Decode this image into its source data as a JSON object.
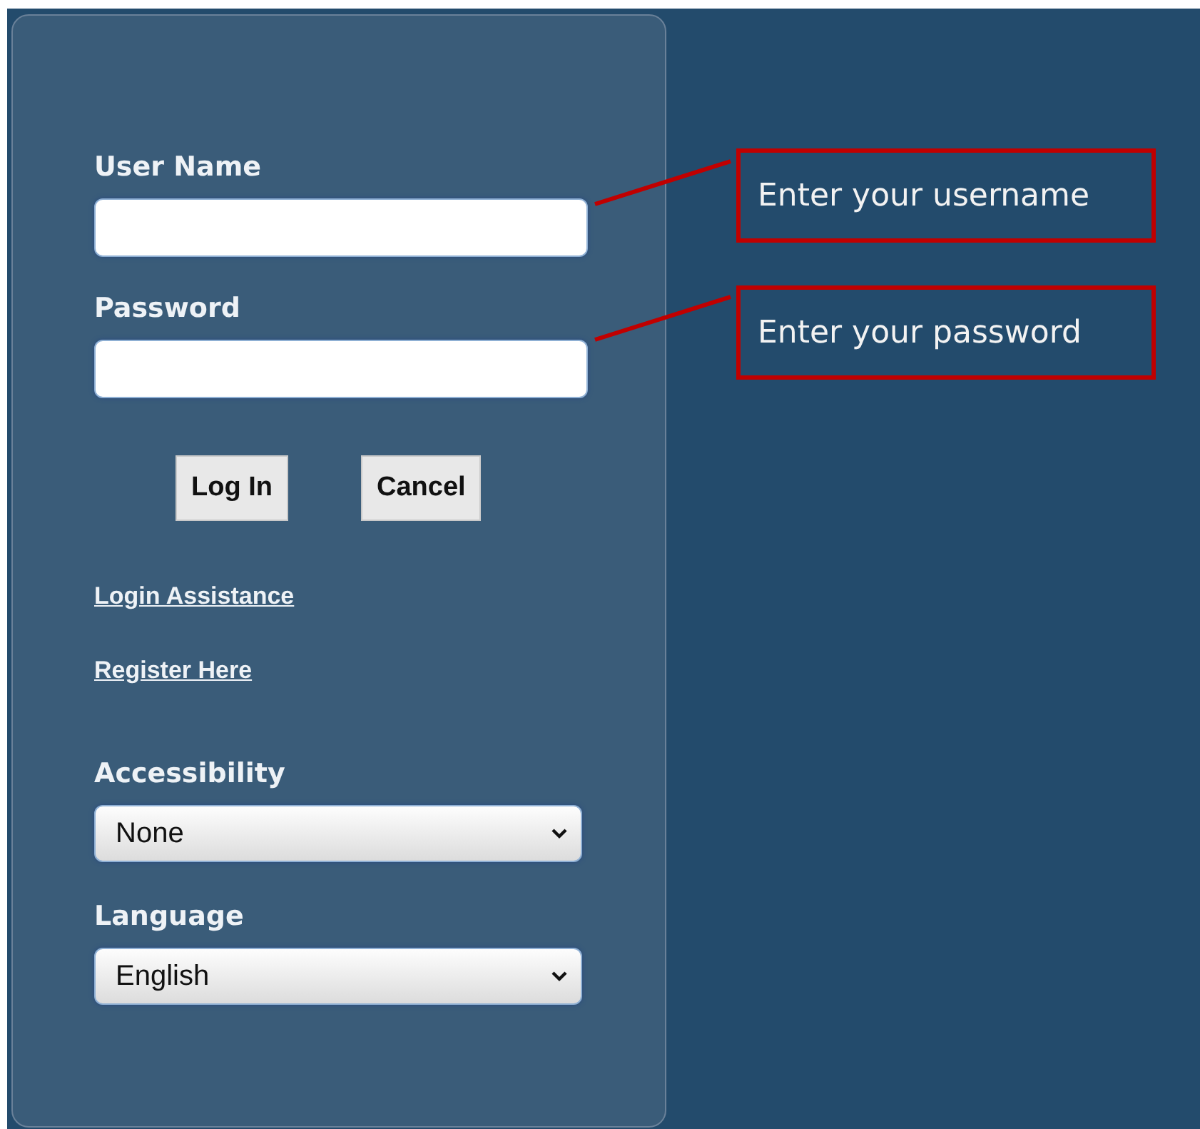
{
  "login_panel": {
    "fields": [
      {
        "label": "User Name",
        "callout": "Enter your username"
      },
      {
        "label": "Password",
        "callout": "Enter your password"
      }
    ],
    "buttons": [
      "Log In",
      "Cancel"
    ],
    "links": [
      "Login Assistance",
      "Register Here"
    ],
    "dropdowns": [
      {
        "label": "Accessibility",
        "value": "None"
      },
      {
        "label": "Language",
        "value": "English"
      }
    ]
  }
}
